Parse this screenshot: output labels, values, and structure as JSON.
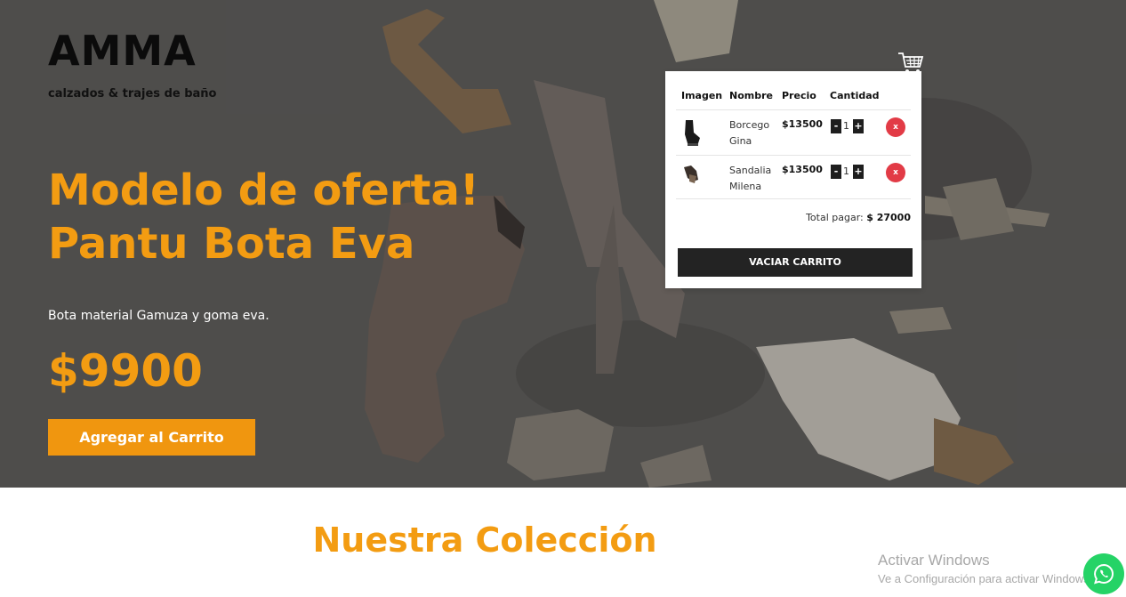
{
  "brand": {
    "name": "AMMA",
    "tagline": "calzados & trajes de baño"
  },
  "hero": {
    "title_line1": "Modelo de oferta!",
    "title_line2": "Pantu Bota Eva",
    "description": "Bota material Gamuza y goma eva.",
    "price": "$9900",
    "add_button": "Agregar al Carrito"
  },
  "cart": {
    "icon": "shopping-cart-icon",
    "headers": {
      "image": "Imagen",
      "name": "Nombre",
      "price": "Precio",
      "quantity": "Cantidad"
    },
    "items": [
      {
        "name_line1": "Borcego",
        "name_line2": "Gina",
        "price": "$13500",
        "minus": "-",
        "qty": "1",
        "plus": "+",
        "remove": "x"
      },
      {
        "name_line1": "Sandalia",
        "name_line2": "Milena",
        "price": "$13500",
        "minus": "-",
        "qty": "1",
        "plus": "+",
        "remove": "x"
      }
    ],
    "total_label": "Total pagar:",
    "total_value": "$ 27000",
    "empty_button": "VACIAR CARRITO"
  },
  "collection": {
    "title": "Nuestra Colección"
  },
  "windows_watermark": {
    "title": "Activar Windows",
    "subtitle": "Ve a Configuración para activar Windows."
  },
  "whatsapp": {
    "icon": "whatsapp-icon"
  },
  "colors": {
    "accent": "#f39c12",
    "button": "#f0960f",
    "hero_bg": "#5b5957",
    "remove": "#e23b46",
    "whatsapp": "#25d366"
  }
}
